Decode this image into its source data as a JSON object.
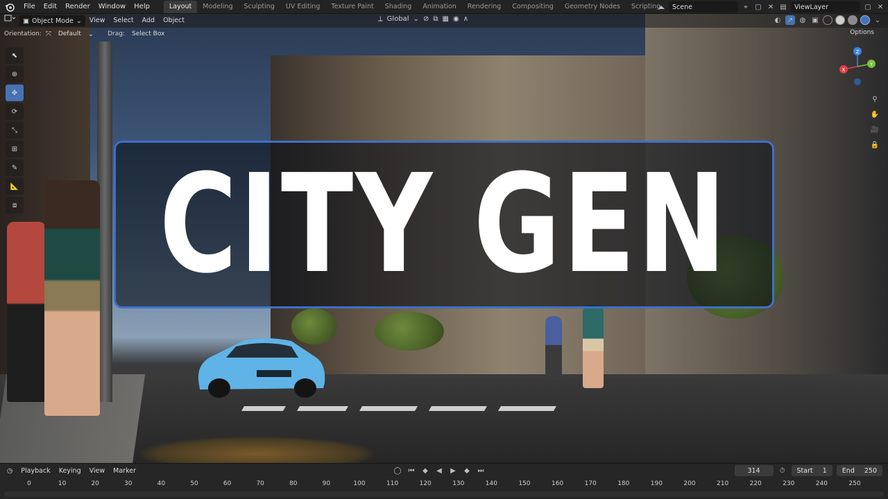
{
  "app": {
    "menu": [
      "File",
      "Edit",
      "Render",
      "Window",
      "Help"
    ],
    "workspaces": [
      "Layout",
      "Modeling",
      "Sculpting",
      "UV Editing",
      "Texture Paint",
      "Shading",
      "Animation",
      "Rendering",
      "Compositing",
      "Geometry Nodes",
      "Scripting"
    ],
    "active_workspace": "Layout",
    "add_workspace": "+",
    "scene": "Scene",
    "view_layer": "ViewLayer"
  },
  "viewport_header": {
    "mode": "Object Mode",
    "menus": [
      "View",
      "Select",
      "Add",
      "Object"
    ],
    "transform_orientation": "Global"
  },
  "tool_settings": {
    "orientation_label": "Orientation:",
    "orientation_value": "Default",
    "drag_label": "Drag:",
    "drag_value": "Select Box",
    "options": "Options"
  },
  "gizmo": {
    "x": "X",
    "y": "Y",
    "z": "Z"
  },
  "overlay": {
    "title": "CITY GEN"
  },
  "timeline": {
    "menus": [
      "Playback",
      "Keying",
      "View",
      "Marker"
    ],
    "current_frame": "314",
    "start_label": "Start",
    "start": "1",
    "end_label": "End",
    "end": "250",
    "ticks": [
      "0",
      "10",
      "20",
      "30",
      "40",
      "50",
      "60",
      "70",
      "80",
      "90",
      "100",
      "110",
      "120",
      "130",
      "140",
      "150",
      "160",
      "170",
      "180",
      "190",
      "200",
      "210",
      "220",
      "230",
      "240",
      "250"
    ]
  },
  "colors": {
    "accent": "#4772b3",
    "title_border": "#3f6fc9",
    "gizmo_x": "#e0404a",
    "gizmo_y": "#79c13a",
    "gizmo_z": "#3f84e0"
  }
}
